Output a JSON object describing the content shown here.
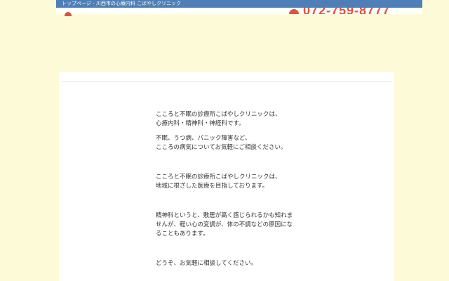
{
  "header": {
    "breadcrumb": "トップページ - 川西市の心療内科 こばやしクリニック",
    "phone": "072-759-8777"
  },
  "main": {
    "paragraphs": [
      "こころと不眠の診療所こばやしクリニックは、\n心療内科・精神科・神経科です。",
      "不眠、うつ病、パニック障害など、\nこころの病気についてお気軽にご相談ください。",
      "こころと不眠の診療所こばやしクリニックは、\n地域に根ざした医療を目指しております。",
      "精神科というと、敷居が高く感じられるかも知れま\nせんが、軽い心の変調が、体の不調などの原因にな\nることもあります。",
      "どうぞ、お気軽に相談してください。"
    ]
  },
  "colors": {
    "background": "#fdfbd7",
    "topbar": "#4f7fb6",
    "accent": "#e8503a"
  },
  "icons": {
    "logo": "clinic-logo-icon",
    "phone": "phone-icon"
  }
}
